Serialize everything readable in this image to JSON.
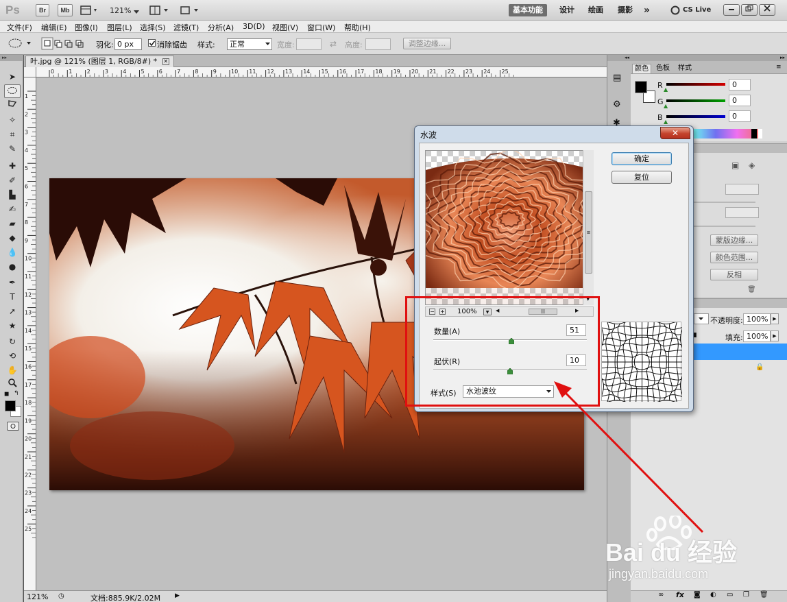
{
  "app": {
    "logo": "Ps",
    "top_buttons": [
      "Br",
      "Mb"
    ],
    "zoom_display": "121%",
    "workspaces": [
      {
        "label": "基本功能",
        "active": true
      },
      {
        "label": "设计",
        "active": false
      },
      {
        "label": "绘画",
        "active": false
      },
      {
        "label": "摄影",
        "active": false
      }
    ],
    "more": "»",
    "cs_live": "CS Live",
    "window_controls": [
      "minimize-icon",
      "restore-icon",
      "close-icon"
    ]
  },
  "menu": [
    "文件(F)",
    "编辑(E)",
    "图像(I)",
    "图层(L)",
    "选择(S)",
    "滤镜(T)",
    "分析(A)",
    "3D(D)",
    "视图(V)",
    "窗口(W)",
    "帮助(H)"
  ],
  "options_bar": {
    "feather_label": "羽化:",
    "feather_value": "0 px",
    "antialias_label": "消除锯齿",
    "antialias_checked": true,
    "style_label": "样式:",
    "style_value": "正常",
    "width_label": "宽度:",
    "height_label": "高度:",
    "refine_edge_button": "调整边缘..."
  },
  "document": {
    "tab_title": "叶.jpg @ 121% (图层 1, RGB/8#) *",
    "ruler_h": [
      "0",
      "1",
      "2",
      "3",
      "4",
      "5",
      "6",
      "7",
      "8",
      "9",
      "10",
      "11",
      "12",
      "13",
      "14",
      "15",
      "16",
      "17",
      "18",
      "19",
      "20",
      "21",
      "22",
      "23",
      "24",
      "25"
    ],
    "ruler_v": [
      "1",
      "2",
      "3",
      "4",
      "5",
      "6",
      "7",
      "8",
      "9",
      "10",
      "11",
      "12",
      "13",
      "14",
      "15",
      "16",
      "17",
      "18",
      "19",
      "20",
      "21",
      "22",
      "23",
      "24",
      "25"
    ],
    "status_zoom": "121%",
    "status_doc": "文档:885.9K/2.02M"
  },
  "color_panel": {
    "tabs": [
      {
        "label": "颜色",
        "active": true
      },
      {
        "label": "色板",
        "active": false
      },
      {
        "label": "样式",
        "active": false
      }
    ],
    "channels": [
      {
        "label": "R",
        "value": "0",
        "color": "#d40000"
      },
      {
        "label": "G",
        "value": "0",
        "color": "#00a000"
      },
      {
        "label": "B",
        "value": "0",
        "color": "#0000d0"
      }
    ]
  },
  "masks_panel": {
    "buttons": [
      "蒙版边缘...",
      "颜色范围...",
      "反相"
    ]
  },
  "layers_panel": {
    "opacity_label": "不透明度:",
    "opacity_value": "100%",
    "fill_label": "填充:",
    "fill_value": "100%"
  },
  "dialog": {
    "title": "水波",
    "ok_button": "确定",
    "reset_button": "复位",
    "zoom_value": "100%",
    "amount_label": "数量(A)",
    "amount_value": "51",
    "amount_level": 51,
    "amount_max": 100,
    "ridges_label": "起伏(R)",
    "ridges_value": "10",
    "ridges_level": 10,
    "ridges_max": 20,
    "style_label": "样式(S)",
    "style_value": "水池波纹"
  },
  "colors": {
    "highlight": "#e01010",
    "accent_blue": "#3399ff"
  },
  "watermark": {
    "text": "Bai du 经验",
    "url": "jingyan.baidu.com"
  }
}
